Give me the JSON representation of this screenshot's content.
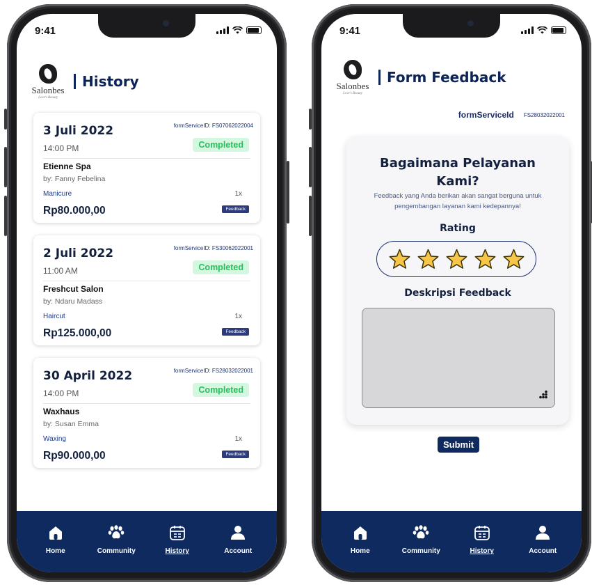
{
  "status_bar": {
    "time": "9:41"
  },
  "brand": {
    "name": "Salonbes",
    "tagline": "Love's Beauty"
  },
  "history": {
    "title": "History",
    "cards": [
      {
        "date": "3 Juli 2022",
        "form_service_id": "formServiceID: FS07062022004",
        "time": "14:00 PM",
        "status": "Completed",
        "salon": "Etienne Spa",
        "stylist": "by: Fanny Febelina",
        "service": "Manicure",
        "qty": "1x",
        "price": "Rp80.000,00",
        "feedback_label": "Feedback"
      },
      {
        "date": "2 Juli 2022",
        "form_service_id": "formServiceID: FS30062022001",
        "time": "11:00 AM",
        "status": "Completed",
        "salon": "Freshcut Salon",
        "stylist": "by: Ndaru Madass",
        "service": "Haircut",
        "qty": "1x",
        "price": "Rp125.000,00",
        "feedback_label": "Feedback"
      },
      {
        "date": "30 April 2022",
        "form_service_id": "formServiceID: FS28032022001",
        "time": "14:00 PM",
        "status": "Completed",
        "salon": "Waxhaus",
        "stylist": "by: Susan Emma",
        "service": "Waxing",
        "qty": "1x",
        "price": "Rp90.000,00",
        "feedback_label": "Feedback"
      }
    ]
  },
  "feedback_form": {
    "title": "Form Feedback",
    "form_service_key": "formServiceId",
    "form_service_value": "FS28032022001",
    "question": "Bagaimana Pelayanan Kami?",
    "description": "Feedback yang Anda berikan akan sangat berguna untuk pengembangan layanan kami kedepannya!",
    "rating_label": "Rating",
    "rating_value": 5,
    "rating_max": 5,
    "description_label": "Deskripsi Feedback",
    "description_value": "",
    "submit_label": "Submit"
  },
  "nav": [
    {
      "label": "Home",
      "icon": "home-icon"
    },
    {
      "label": "Community",
      "icon": "paw-icon"
    },
    {
      "label": "History",
      "icon": "calendar-icon"
    },
    {
      "label": "Account",
      "icon": "user-icon"
    }
  ],
  "colors": {
    "navy": "#0e2a5f",
    "completed_bg": "#d4f7df",
    "completed_text": "#2bbf5b",
    "star": "#f7c547"
  }
}
